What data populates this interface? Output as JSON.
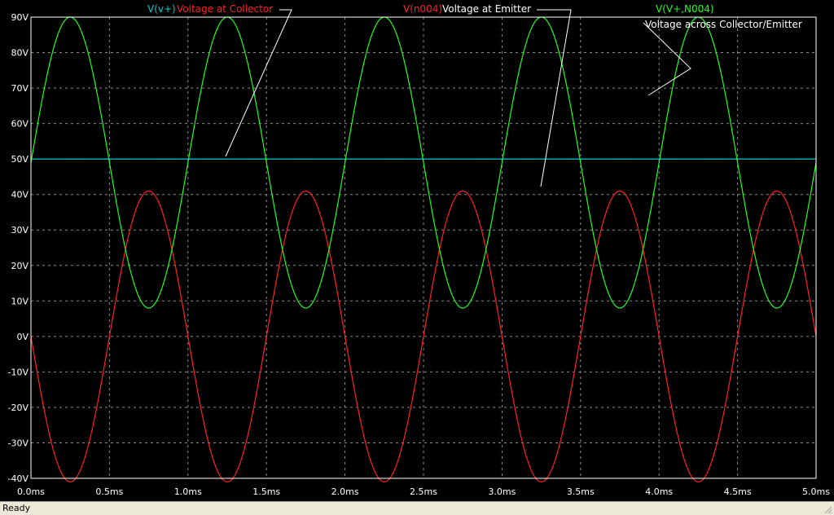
{
  "status": {
    "text": "Ready"
  },
  "colors": {
    "background": "#000000",
    "grid": "#8a8a8a",
    "frame": "#ffffff",
    "v_plus": "#00cccc",
    "v_n004": "#ff2020",
    "v_vplus_n004": "#20ff20",
    "annotation": "#ffffff"
  },
  "legend": {
    "vplus_name": "V(v+)",
    "vplus_desc": "Voltage at Collector",
    "n004_name": "V(n004)",
    "n004_desc": "Voltage at Emitter",
    "diff_name": "V(V+,N004)",
    "diff_desc": "Voltage across Collector/Emitter"
  },
  "chart_data": {
    "type": "line",
    "title": "",
    "xlabel": "",
    "ylabel": "",
    "xlim": [
      0,
      5.0
    ],
    "ylim": [
      -40,
      90
    ],
    "grid": true,
    "x_unit": "ms",
    "y_unit": "V",
    "x_ticks": [
      "0.0ms",
      "0.5ms",
      "1.0ms",
      "1.5ms",
      "2.0ms",
      "2.5ms",
      "3.0ms",
      "3.5ms",
      "4.0ms",
      "4.5ms",
      "5.0ms"
    ],
    "y_ticks": [
      "90V",
      "80V",
      "70V",
      "60V",
      "50V",
      "40V",
      "30V",
      "20V",
      "10V",
      "0V",
      "-10V",
      "-20V",
      "-30V",
      "-40V"
    ],
    "series": [
      {
        "name": "V(v+)",
        "kind": "constant",
        "value": 50,
        "color": "#00cccc"
      },
      {
        "name": "V(n004)",
        "kind": "sine",
        "offset": 0,
        "amplitude": -41,
        "frequency_khz": 1.0,
        "color": "#ff2020"
      },
      {
        "name": "V(V+,N004)",
        "kind": "sine",
        "offset": 49,
        "amplitude": -41,
        "frequency_khz": 1.0,
        "phase_deg": 180,
        "color": "#20ff20"
      }
    ]
  }
}
